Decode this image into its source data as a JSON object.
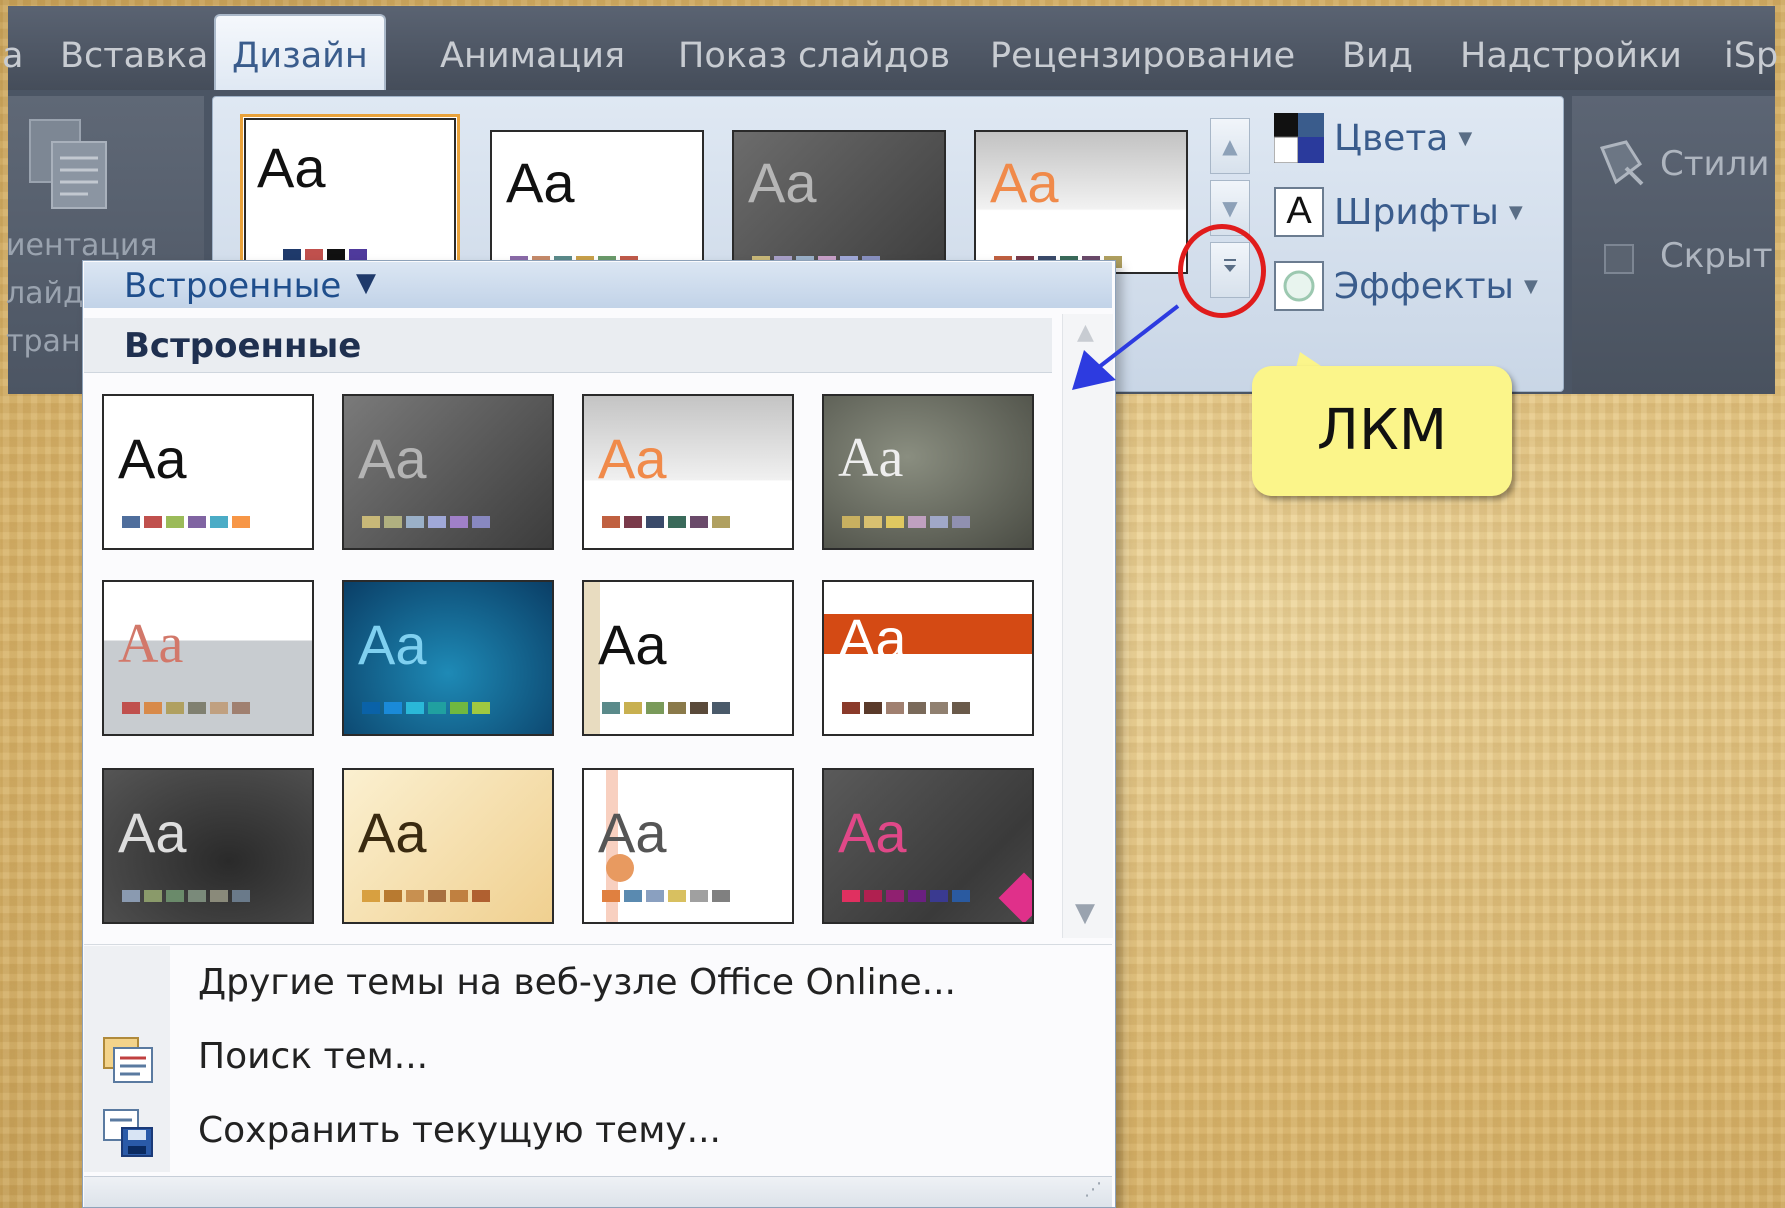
{
  "tabs": {
    "partial_left": "а",
    "items": [
      "Вставка",
      "Дизайн",
      "Анимация",
      "Показ слайдов",
      "Рецензирование",
      "Вид",
      "Надстройки"
    ],
    "partial_right": "iSp",
    "active": "Дизайн"
  },
  "left_group": {
    "line1": "иентация",
    "line2": "лайд",
    "line3": "тран"
  },
  "commands": {
    "colors": "Цвета",
    "fonts": "Шрифты",
    "effects": "Эффекты"
  },
  "right_group": {
    "styles": "Стили",
    "hide": "Скрыт"
  },
  "theme_sample": "Aa",
  "dropdown": {
    "header": "Встроенные",
    "section": "Встроенные",
    "menu": {
      "online": "Другие темы на веб-узле Office Online...",
      "search": "Поиск тем...",
      "save": "Сохранить текущую тему..."
    }
  },
  "callout": {
    "text": "ЛКМ"
  },
  "colors": {
    "annotation_circle": "#e01c1c",
    "arrow": "#2d3be0",
    "callout_fill": "#fbf58a",
    "link_text": "#3a5c8c"
  }
}
